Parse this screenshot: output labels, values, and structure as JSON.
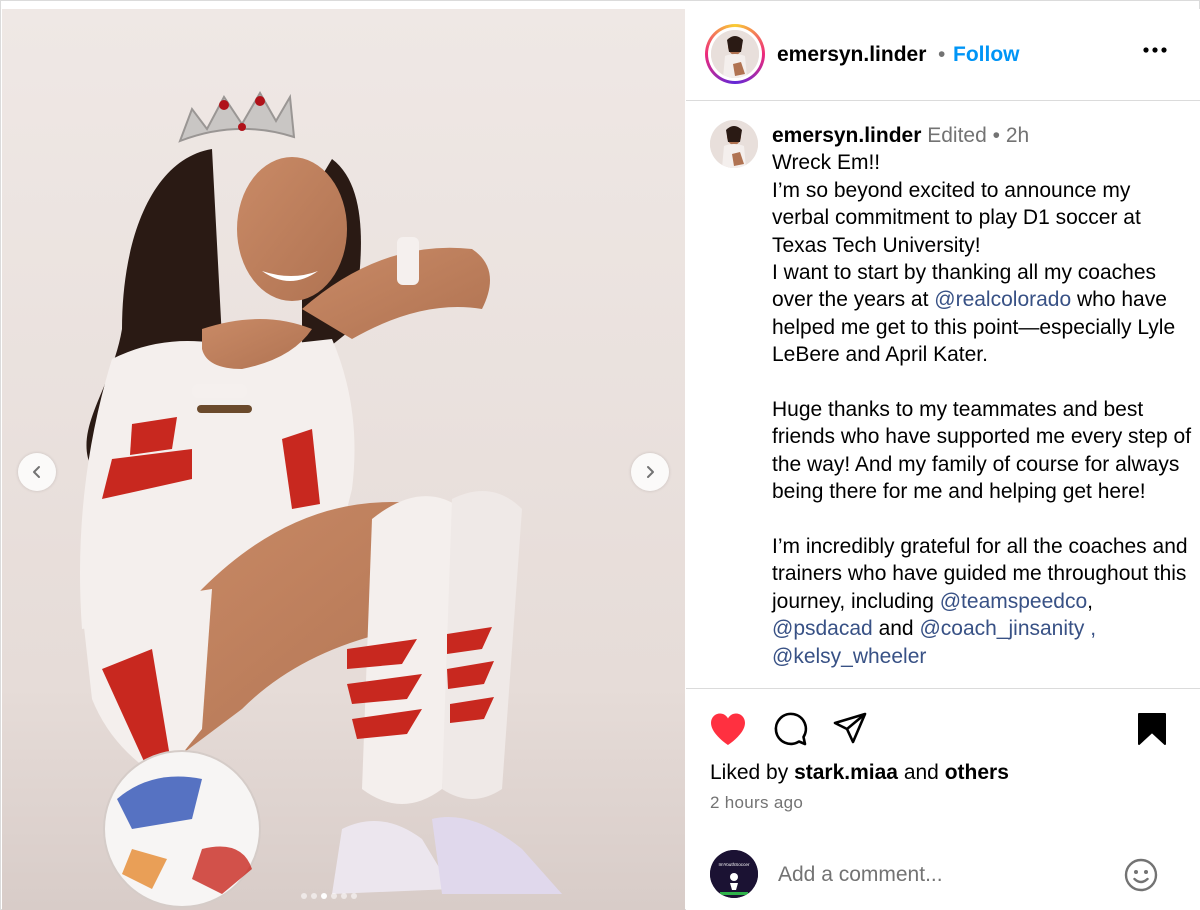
{
  "post": {
    "media": {
      "carousel_count": 6,
      "active_index": 2,
      "prev_icon": "chevron-left-icon",
      "next_icon": "chevron-right-icon"
    },
    "header": {
      "username": "emersyn.linder",
      "separator": "•",
      "follow_label": "Follow",
      "more_icon": "more-horizontal-icon"
    },
    "caption": {
      "username": "emersyn.linder",
      "edited": "Edited",
      "dot": "•",
      "time": "2h",
      "line1": "Wreck Em!!",
      "para1": "I’m so beyond excited to announce my verbal commitment to play D1 soccer at Texas Tech University!",
      "para2_a": "I want to start by thanking all my coaches over the years at",
      "mention_realcolorado": "@realcolorado",
      "para2_b": "who have helped me get to this point—especially Lyle LeBere and April Kater.",
      "para3": "Huge thanks to my teammates and best friends who have supported me every step of the way! And my family of course for always being there for me and helping get here!",
      "para4": "I’m incredibly grateful for all the coaches and trainers who have guided me throughout this journey, including",
      "mention_teamspeedco": "@teamspeedco",
      "comma": ",",
      "mention_psdacad": "@psdacad",
      "and": "and",
      "mention_cut": "@coach_jinsanity , @kelsy_wheeler"
    },
    "actions": {
      "liked": true,
      "saved": true,
      "likes_prefix": "Liked by",
      "liked_by_user": "stark.miaa",
      "likes_middle": "and",
      "likes_others": "others",
      "time_ago": "2 hours ago"
    },
    "comment": {
      "placeholder": "Add a comment...",
      "avatar_text": "ImYouthSoccer"
    }
  },
  "colors": {
    "accent_link": "#0095f6",
    "mention": "#385185",
    "like_red": "#ff3040",
    "muted": "#737373"
  }
}
